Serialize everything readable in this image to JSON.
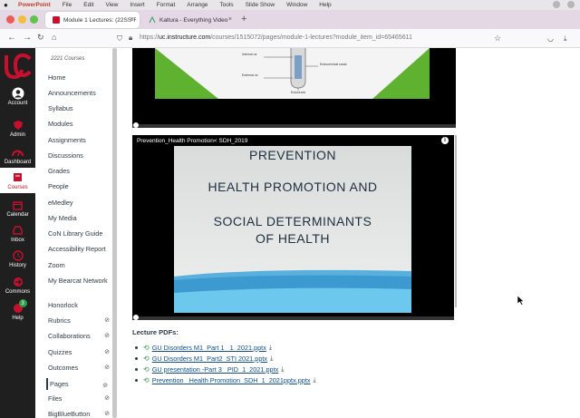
{
  "menubar": {
    "app": "PowerPoint",
    "items": [
      "File",
      "Edit",
      "View",
      "Insert",
      "Format",
      "Arrange",
      "Tools",
      "Slide Show",
      "Window",
      "Help"
    ]
  },
  "browser": {
    "tabs": [
      {
        "title": "Module 1 Lectures: (22SS-Full)",
        "active": true
      },
      {
        "title": "Kaltura - Everything Video",
        "active": false
      }
    ],
    "url_prefix": "https://",
    "url_host": "uc.instructure.com",
    "url_path": "/courses/1515072/pages/module-1-lectures?module_item_id=65465611"
  },
  "global_nav": [
    {
      "label": "Account",
      "icon": "avatar-icon"
    },
    {
      "label": "Admin",
      "icon": "admin-shield-icon"
    },
    {
      "label": "Dashboard",
      "icon": "dashboard-icon"
    },
    {
      "label": "Courses",
      "icon": "courses-book-icon",
      "active": true
    },
    {
      "label": "Calendar",
      "icon": "calendar-icon"
    },
    {
      "label": "Inbox",
      "icon": "inbox-icon"
    },
    {
      "label": "History",
      "icon": "history-clock-icon"
    },
    {
      "label": "Commons",
      "icon": "commons-icon"
    },
    {
      "label": "Help",
      "icon": "help-icon",
      "badge": "3"
    }
  ],
  "course_nav": {
    "term": "2221 Courses",
    "items": [
      {
        "label": "Home"
      },
      {
        "label": "Announcements"
      },
      {
        "label": "Syllabus"
      },
      {
        "label": "Modules"
      },
      {
        "label": "Assignments"
      },
      {
        "label": "Discussions"
      },
      {
        "label": "Grades"
      },
      {
        "label": "People"
      },
      {
        "label": "eMedley"
      },
      {
        "label": "My Media"
      },
      {
        "label": "CoN Library Guide"
      },
      {
        "label": "Accessibility Report"
      },
      {
        "label": "Zoom"
      },
      {
        "label": "My Bearcat Network"
      },
      {
        "label": "Honorlock"
      },
      {
        "label": "Rubrics",
        "hidden": true
      },
      {
        "label": "Collaborations",
        "hidden": true
      },
      {
        "label": "Quizzes",
        "hidden": true
      },
      {
        "label": "Outcomes",
        "hidden": true
      },
      {
        "label": "Pages",
        "hidden": true,
        "active": true
      },
      {
        "label": "Files",
        "hidden": true
      },
      {
        "label": "BigBlueButton",
        "hidden": true
      }
    ]
  },
  "slide1": {
    "labels": [
      "Internal os",
      "Endocervical canal",
      "External os",
      "Ectocervix"
    ]
  },
  "player2": {
    "title": "Prevention_Health Promotion< SDH_2019",
    "slide_lines": [
      "PREVENTION",
      "HEALTH PROMOTION AND",
      "SOCIAL DETERMINANTS",
      "OF HEALTH"
    ]
  },
  "lecture_pdfs": {
    "heading": "Lecture PDFs:",
    "files": [
      "GU Disorders M1_Part 1_ 1_2021.pptx",
      "GU Disorders M1_Part2_STI 2021.pptx",
      "GU presentation -Part 3_ PID_1_2021.pptx",
      "Prevention_ Health Promotion_SDH_1_2021pptx.pptx"
    ]
  },
  "colors": {
    "uc_red": "#c8102e",
    "nav_dark": "#1f1f1f",
    "link": "#0e4f8b"
  }
}
